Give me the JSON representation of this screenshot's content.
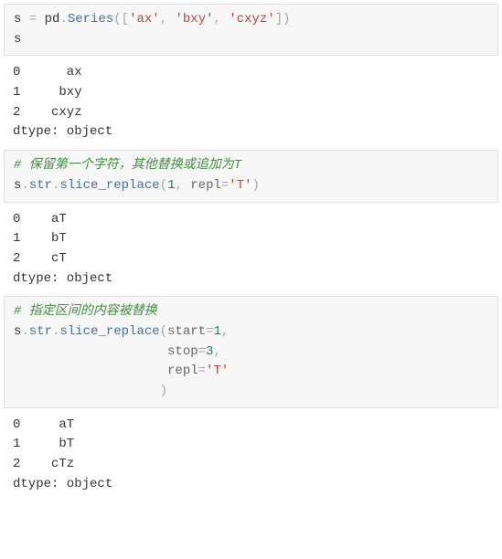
{
  "cell1": {
    "code": {
      "s": "s",
      "eq": " = ",
      "pd": "pd",
      "dot1": ".",
      "series": "Series",
      "lp": "(",
      "lb": "[",
      "str1": "'ax'",
      "c1": ", ",
      "str2": "'bxy'",
      "c2": ", ",
      "str3": "'cxyz'",
      "rb": "]",
      "rp": ")",
      "line2": "s"
    },
    "output": "0      ax\n1     bxy\n2    cxyz\ndtype: object"
  },
  "cell2": {
    "code": {
      "comment": "# 保留第一个字符，其他替换或追加为T",
      "s": "s",
      "dot1": ".",
      "str_": "str",
      "dot2": ".",
      "fn": "slice_replace",
      "lp": "(",
      "n1": "1",
      "c1": ", ",
      "kw1": "repl",
      "eq1": "=",
      "v1": "'T'",
      "rp": ")"
    },
    "output": "0    aT\n1    bT\n2    cT\ndtype: object"
  },
  "cell3": {
    "code": {
      "comment": "# 指定区间的内容被替换",
      "s": "s",
      "dot1": ".",
      "str_": "str",
      "dot2": ".",
      "fn": "slice_replace",
      "lp": "(",
      "kw1": "start",
      "eq1": "=",
      "v1": "1",
      "c1": ",",
      "pad2": "                    ",
      "kw2": "stop",
      "eq2": "=",
      "v2": "3",
      "c2": ",",
      "pad3": "                    ",
      "kw3": "repl",
      "eq3": "=",
      "v3": "'T'",
      "pad4": "                   ",
      "rp": ")"
    },
    "output": "0     aT\n1     bT\n2    cTz\ndtype: object"
  }
}
